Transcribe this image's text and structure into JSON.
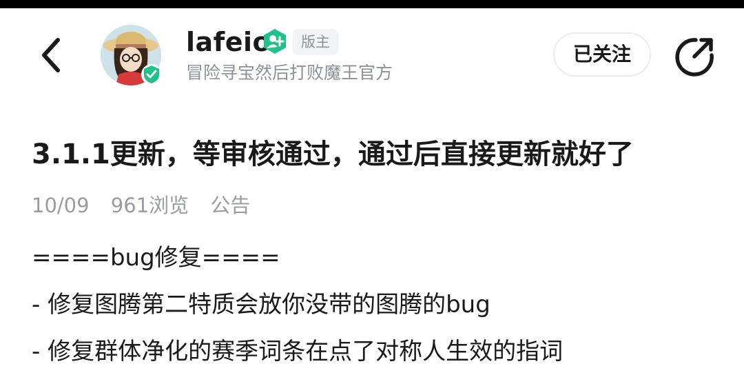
{
  "header": {
    "back_icon": "chevron-left-icon",
    "author_name": "lafeio",
    "author_role_badge": "版主",
    "author_bio": "冒险寻宝然后打败魔王官方",
    "follow_label": "已关注",
    "share_icon": "share-icon",
    "verified_icon": "verified-check-icon",
    "moderator_icon": "moderator-icon",
    "accent_color": "#21c28a"
  },
  "post": {
    "title": "3.1.1更新，等审核通过，通过后直接更新就好了",
    "date": "10/09",
    "views": "961浏览",
    "category": "公告",
    "body_lines": [
      "====bug修复====",
      "- 修复图腾第二特质会放你没带的图腾的bug",
      "- 修复群体净化的赛季词条在点了对称人生效的指词"
    ]
  }
}
